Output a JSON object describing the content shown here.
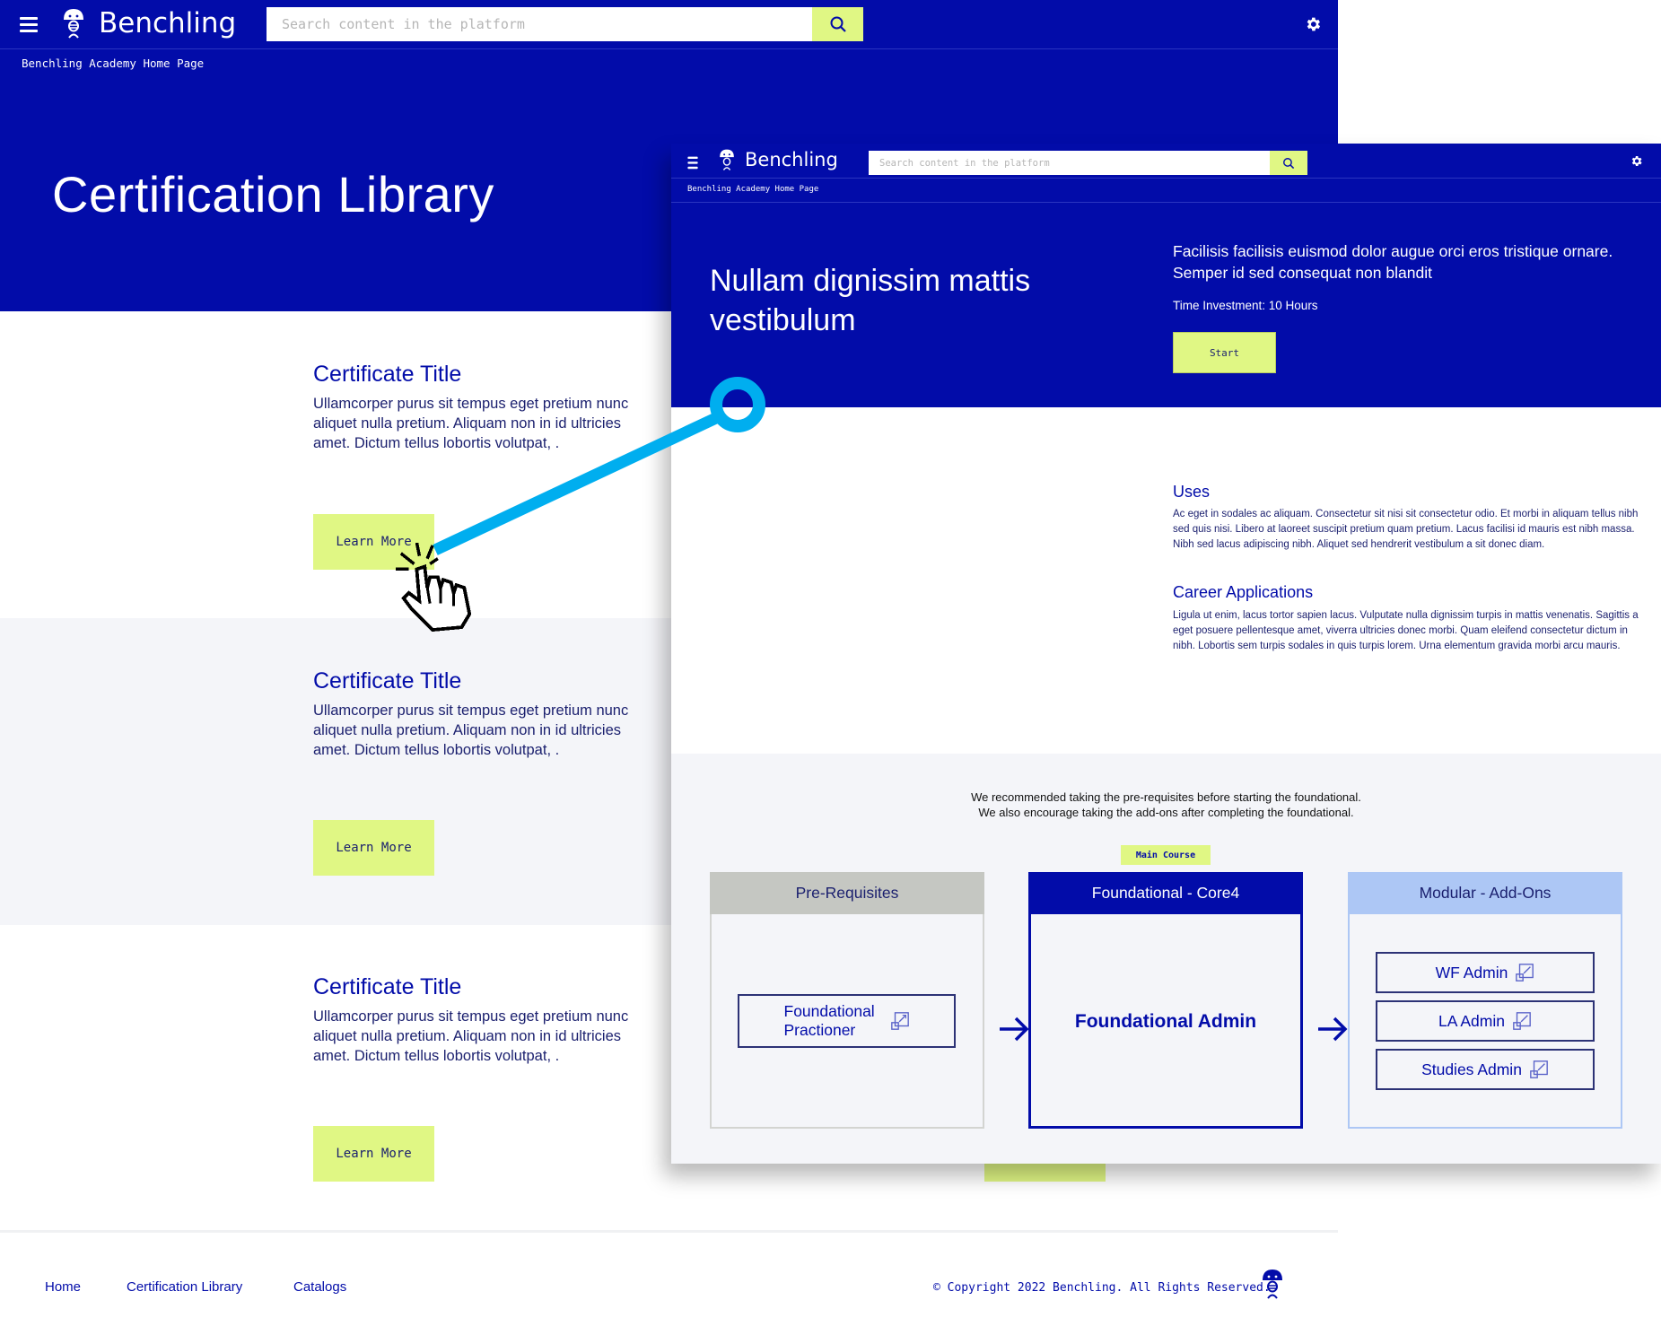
{
  "app": {
    "brand": "Benchling",
    "search_placeholder": "Search content in the platform",
    "breadcrumb": "Benchling Academy Home Page"
  },
  "library_page": {
    "title": "Certification Library",
    "certificates": [
      {
        "title": "Certificate Title",
        "description": "Ullamcorper purus sit tempus eget pretium nunc aliquet nulla pretium. Aliquam non in id ultricies amet. Dictum tellus lobortis volutpat, .",
        "button": "Learn More"
      },
      {
        "title": "Certificate Title",
        "description": "Ullamcorper purus sit tempus eget pretium nunc aliquet nulla pretium. Aliquam non in id ultricies amet. Dictum tellus lobortis volutpat, .",
        "button": "Learn More"
      },
      {
        "title": "Certificate Title",
        "description": "Ullamcorper purus sit tempus eget pretium nunc aliquet nulla pretium. Aliquam non in id ultricies amet. Dictum tellus lobortis volutpat, .",
        "button": "Learn More"
      }
    ],
    "footer": {
      "links": [
        "Home",
        "Certification Library",
        "Catalogs"
      ],
      "copyright": "© Copyright 2022 Benchling. All Rights Reserved."
    }
  },
  "detail_page": {
    "title": "Nullam dignissim mattis vestibulum",
    "intro": "Facilisis facilisis euismod dolor augue orci eros tristique ornare. Semper id sed consequat non blandit",
    "time_investment": "Time Investment: 10 Hours",
    "start_button": "Start",
    "uses": {
      "heading": "Uses",
      "body": "Ac eget in sodales ac aliquam. Consectetur sit nisi sit consectetur odio. Et morbi in aliquam tellus nibh sed quis nisi. Libero at laoreet suscipit pretium quam pretium. Lacus facilisi id mauris est nibh massa. Nibh sed lacus adipiscing nibh. Aliquet sed hendrerit vestibulum a sit donec diam."
    },
    "career": {
      "heading": "Career Applications",
      "body": "Ligula ut enim, lacus tortor sapien lacus. Vulputate nulla dignissim turpis in mattis venenatis. Sagittis a eget posuere pellentesque amet, viverra ultricies donec morbi. Quam eleifend consectetur dictum in nibh. Lobortis sem turpis sodales in quis turpis lorem. Urna elementum gravida morbi arcu mauris."
    },
    "path_note_line1": "We recommended taking the pre-requisites before starting the foundational.",
    "path_note_line2": "We also encourage taking the add-ons after completing the foundational.",
    "main_badge": "Main Course",
    "columns": {
      "prereq": {
        "heading": "Pre-Requisites",
        "items": [
          "Foundational Practioner"
        ]
      },
      "core": {
        "heading": "Foundational - Core4",
        "item": "Foundational Admin"
      },
      "addons": {
        "heading": "Modular - Add-Ons",
        "items": [
          "WF Admin",
          "LA Admin",
          "Studies Admin"
        ]
      }
    }
  },
  "colors": {
    "brand_blue": "#020ca9",
    "accent_lime": "#e0f784",
    "connector": "#00aeef",
    "pale_bg": "#f4f5f9",
    "addon_blue": "#adc7f5",
    "prereq_grey": "#c5c7c2"
  },
  "icons": [
    "menu-icon",
    "mascot-logo-icon",
    "search-icon",
    "gear-icon",
    "external-link-icon",
    "arrow-right-icon",
    "pointer-hand-icon"
  ]
}
